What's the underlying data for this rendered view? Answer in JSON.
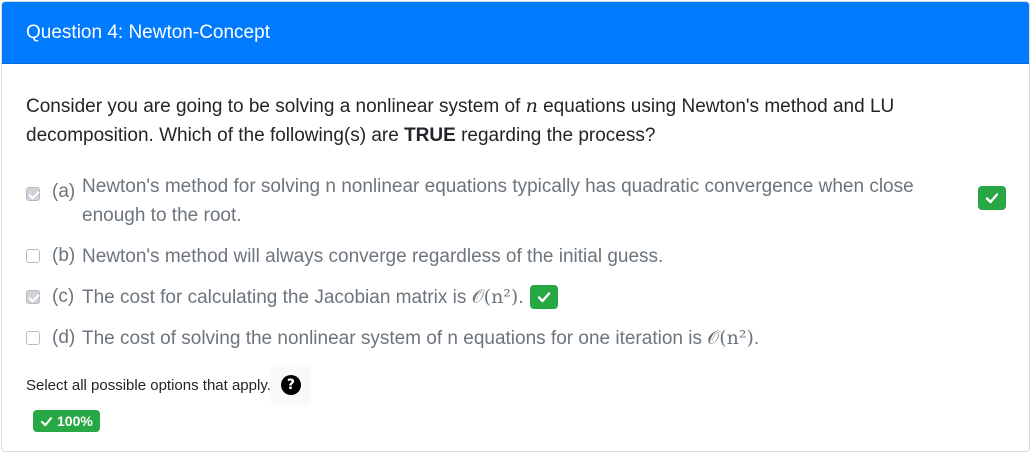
{
  "question": {
    "title": "Question 4: Newton-Concept",
    "prompt_before": "Consider you are going to be solving a nonlinear system of ",
    "prompt_var": "n",
    "prompt_mid": " equations using Newton's method and LU decomposition. Which of the following(s) are ",
    "prompt_bold": "TRUE",
    "prompt_after": " regarding the process?"
  },
  "options": [
    {
      "letter": "(a)",
      "text": "Newton's method for solving n nonlinear equations typically has quadratic convergence when close enough to the root.",
      "checked": true,
      "correct_badge": true
    },
    {
      "letter": "(b)",
      "text": "Newton's method will always converge regardless of the initial guess.",
      "checked": false,
      "correct_badge": false
    },
    {
      "letter": "(c)",
      "text": "The cost for calculating the Jacobian matrix is ",
      "math": "𝒪(n²)",
      "suffix": ".",
      "checked": true,
      "correct_badge": true
    },
    {
      "letter": "(d)",
      "text": "The cost of solving the nonlinear system of n equations for one iteration is ",
      "math": "𝒪(n²)",
      "suffix": ".",
      "checked": false,
      "correct_badge": false
    }
  ],
  "hint": {
    "text": "Select all possible options that apply.",
    "help_icon": "question-circle-icon"
  },
  "score": {
    "label": "100%",
    "icon": "check-icon"
  },
  "colors": {
    "header_bg": "#007bff",
    "correct_green": "#28a745",
    "option_text": "#6c757d"
  }
}
